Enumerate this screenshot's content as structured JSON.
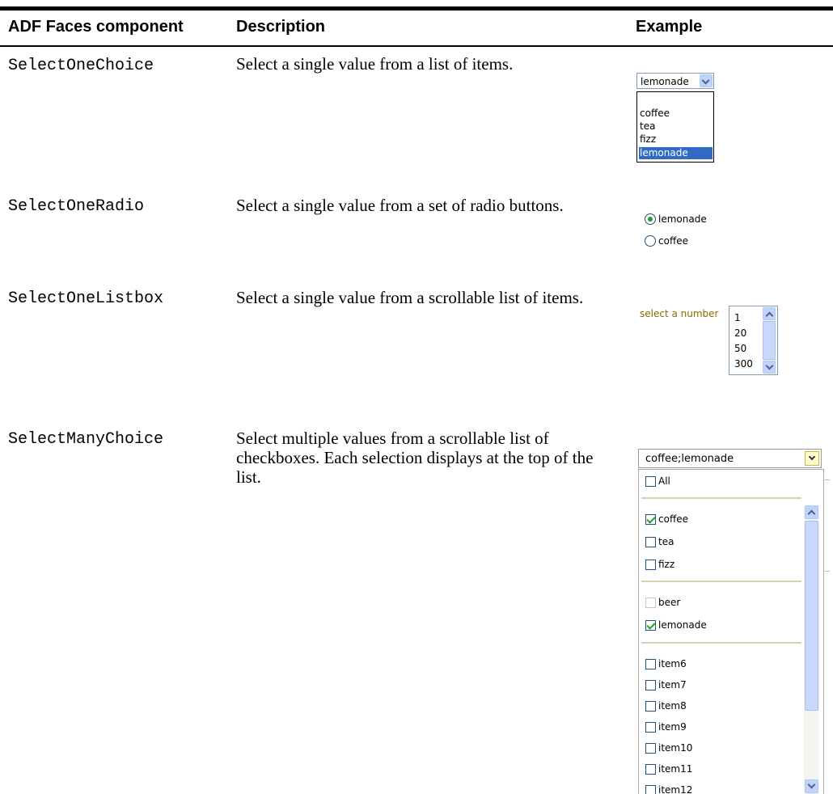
{
  "table": {
    "headers": {
      "component": "ADF Faces component",
      "description": "Description",
      "example": "Example"
    },
    "rows": [
      {
        "component": "SelectOneChoice",
        "description": "Select a single value from a list of items."
      },
      {
        "component": "SelectOneRadio",
        "description": "Select a single value from a set of radio buttons."
      },
      {
        "component": "SelectOneListbox",
        "description": "Select a single value from a scrollable list of items."
      },
      {
        "component": "SelectManyChoice",
        "description": "Select multiple values from a scrollable list of checkboxes. Each selection displays at the top of the list."
      }
    ]
  },
  "examples": {
    "select_one_choice": {
      "value": "lemonade",
      "options": [
        "coffee",
        "tea",
        "fizz",
        "lemonade"
      ],
      "selected_option": "lemonade",
      "highlight_color": "#316ac5"
    },
    "select_one_radio": {
      "options": [
        {
          "label": "lemonade",
          "selected": true
        },
        {
          "label": "coffee",
          "selected": false
        }
      ]
    },
    "select_one_listbox": {
      "label": "select a number",
      "items": [
        "1",
        "20",
        "50",
        "300"
      ]
    },
    "select_many_choice": {
      "value": "coffee;lemonade",
      "all_label": "All",
      "items": [
        {
          "label": "coffee",
          "checked": true
        },
        {
          "label": "tea",
          "checked": false
        },
        {
          "label": "fizz",
          "checked": false
        },
        {
          "label": "beer",
          "checked": false,
          "disabled": true
        },
        {
          "label": "lemonade",
          "checked": true
        },
        {
          "label": "item6",
          "checked": false
        },
        {
          "label": "item7",
          "checked": false
        },
        {
          "label": "item8",
          "checked": false
        },
        {
          "label": "item9",
          "checked": false
        },
        {
          "label": "item10",
          "checked": false
        },
        {
          "label": "item11",
          "checked": false
        },
        {
          "label": "item12",
          "checked": false
        }
      ],
      "check_color": "#21a121"
    }
  }
}
